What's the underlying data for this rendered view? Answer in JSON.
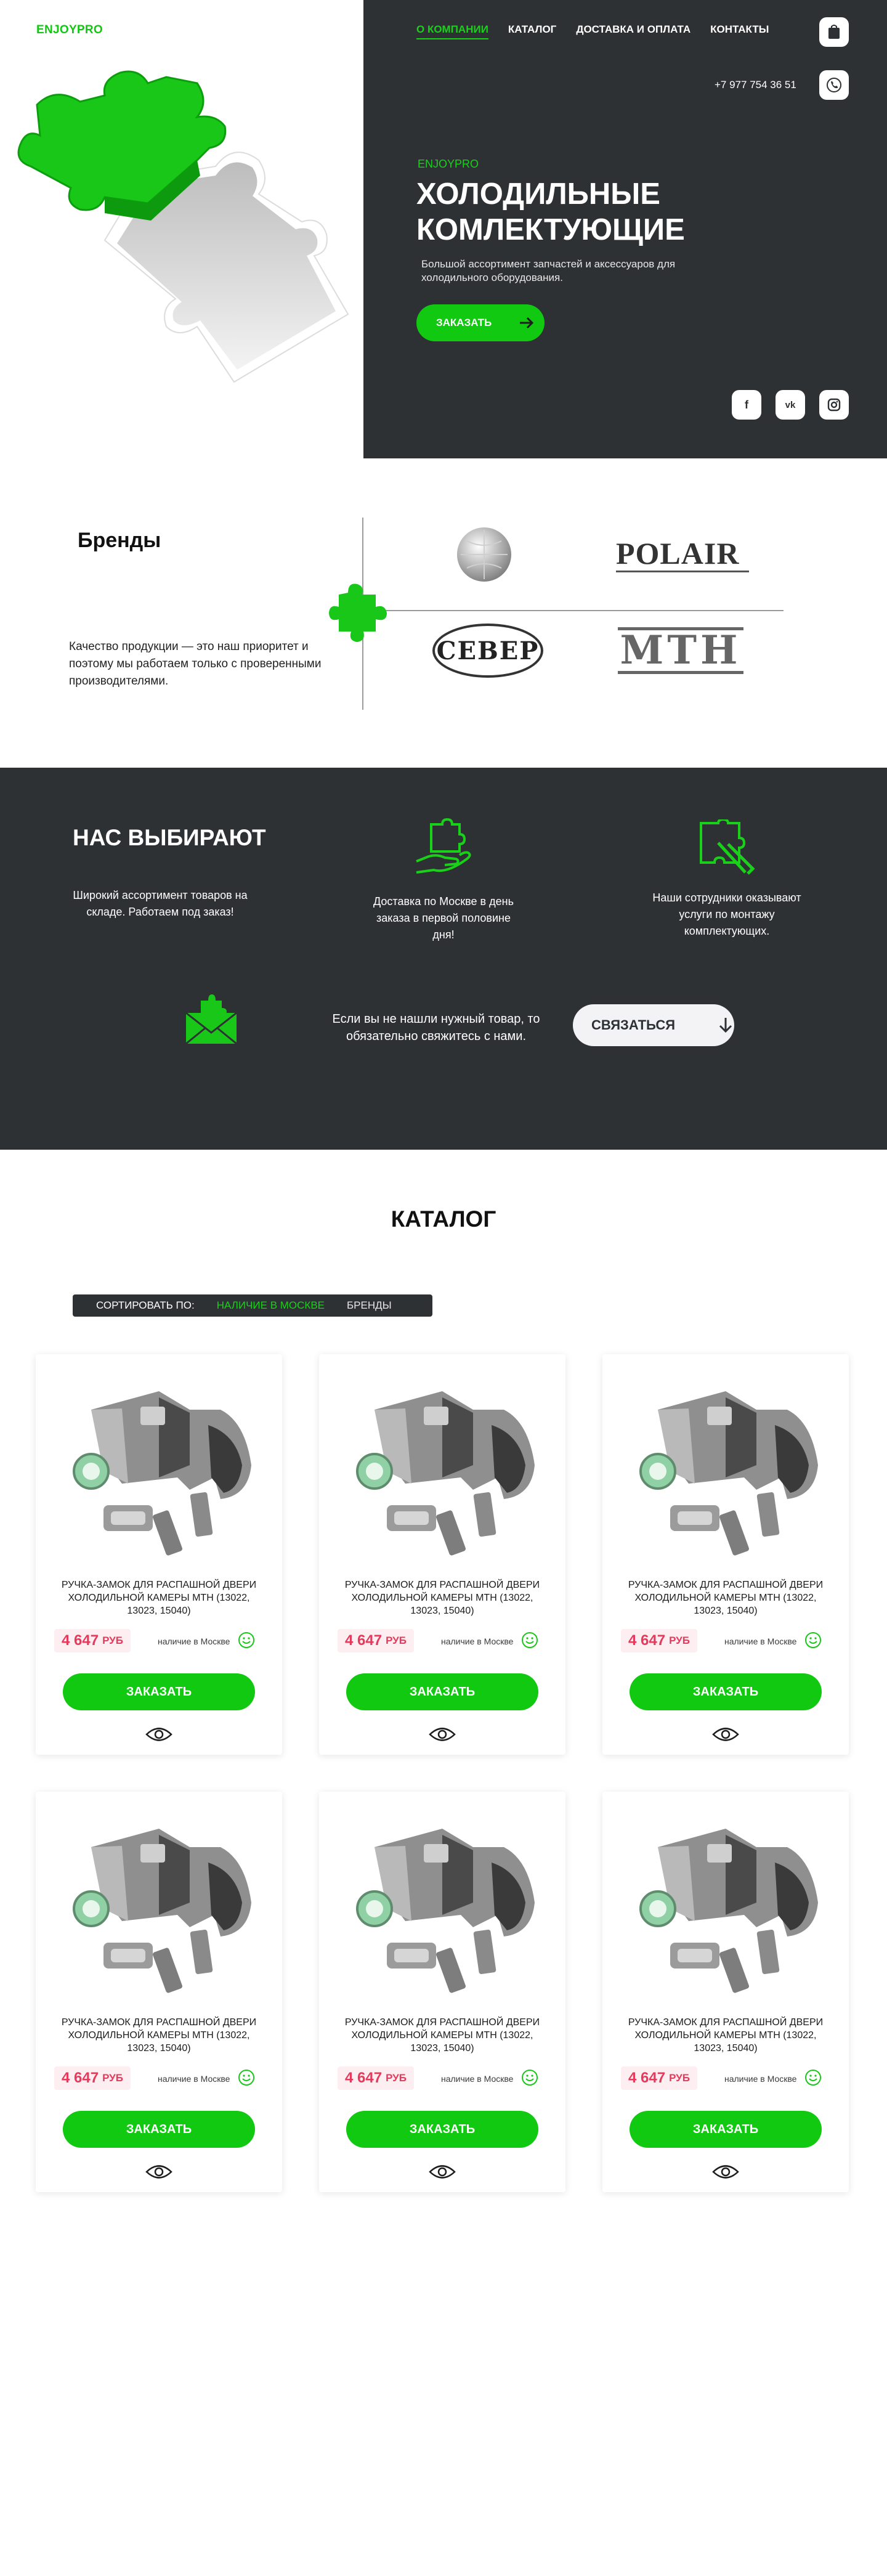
{
  "header": {
    "logo": "ENJOYPRO",
    "nav": [
      {
        "label": "О КОМПАНИИ",
        "active": true
      },
      {
        "label": "КАТАЛОГ",
        "active": false
      },
      {
        "label": "ДОСТАВКА И ОПЛАТА",
        "active": false
      },
      {
        "label": "КОНТАКТЫ",
        "active": false
      }
    ],
    "cart_icon": "cart-icon",
    "phone": "+7 977 754 36 51",
    "phone_icon": "phone-icon"
  },
  "hero": {
    "brand": "ENJOYPRO",
    "title": "ХОЛОДИЛЬНЫЕ КОМЛЕКТУЮЩИЕ",
    "subtitle": "Большой ассортимент запчастей и аксессуаров для холодильного оборудования.",
    "order_label": "ЗАКАЗАТЬ",
    "social": [
      "facebook-icon",
      "vk-icon",
      "instagram-icon"
    ]
  },
  "brands": {
    "title": "Бренды",
    "description": "Качество продукции — это наш приоритет и поэтому мы работаем только с проверенными производителями.",
    "logos": [
      {
        "name": "globe-logo",
        "text": ""
      },
      {
        "name": "polair-logo",
        "text": "POLAIR"
      },
      {
        "name": "sever-logo",
        "text": "СЕВЕР"
      },
      {
        "name": "mtn-logo",
        "text": "МТН"
      }
    ]
  },
  "why_us": {
    "title": "НАС ВЫБИРАЮТ",
    "features": [
      {
        "text": "Широкий ассортимент товаров на складе. Работаем под заказ!",
        "icon": ""
      },
      {
        "text": "Доставка по Москве в день заказа в первой половине дня!",
        "icon": "hand-puzzle-icon"
      },
      {
        "text": "Наши сотрудники оказывают услуги по монтажу комплектующих.",
        "icon": "puzzle-tools-icon"
      }
    ],
    "contact_text": "Если вы не нашли нужный  товар, то обязательно свяжитесь с нами.",
    "contact_icon": "mail-puzzle-icon",
    "contact_button": "СВЯЗАТЬСЯ"
  },
  "catalog": {
    "title": "КАТАЛОГ",
    "sort_label": "СОРТИРОВАТЬ ПО:",
    "sort_options": [
      {
        "label": "НАЛИЧИЕ В МОСКВЕ",
        "active": true
      },
      {
        "label": "БРЕНДЫ",
        "active": false
      }
    ],
    "products": [
      {
        "name": "РУЧКА-ЗАМОК ДЛЯ РАСПАШНОЙ ДВЕРИ ХОЛОДИЛЬНОЙ КАМЕРЫ МТН (13022, 13023, 15040)",
        "price": "4 647",
        "currency": "РУБ",
        "stock": "наличие в Москве",
        "button": "ЗАКАЗАТЬ"
      },
      {
        "name": "РУЧКА-ЗАМОК ДЛЯ РАСПАШНОЙ ДВЕРИ ХОЛОДИЛЬНОЙ КАМЕРЫ МТН (13022, 13023, 15040)",
        "price": "4 647",
        "currency": "РУБ",
        "stock": "наличие в Москве",
        "button": "ЗАКАЗАТЬ"
      },
      {
        "name": "РУЧКА-ЗАМОК ДЛЯ РАСПАШНОЙ ДВЕРИ ХОЛОДИЛЬНОЙ КАМЕРЫ МТН (13022, 13023, 15040)",
        "price": "4 647",
        "currency": "РУБ",
        "stock": "наличие в Москве",
        "button": "ЗАКАЗАТЬ"
      },
      {
        "name": "РУЧКА-ЗАМОК ДЛЯ РАСПАШНОЙ ДВЕРИ ХОЛОДИЛЬНОЙ КАМЕРЫ МТН (13022, 13023, 15040)",
        "price": "4 647",
        "currency": "РУБ",
        "stock": "наличие в Москве",
        "button": "ЗАКАЗАТЬ"
      },
      {
        "name": "РУЧКА-ЗАМОК ДЛЯ РАСПАШНОЙ ДВЕРИ ХОЛОДИЛЬНОЙ КАМЕРЫ МТН (13022, 13023, 15040)",
        "price": "4 647",
        "currency": "РУБ",
        "stock": "наличие в Москве",
        "button": "ЗАКАЗАТЬ"
      },
      {
        "name": "РУЧКА-ЗАМОК ДЛЯ РАСПАШНОЙ ДВЕРИ ХОЛОДИЛЬНОЙ КАМЕРЫ МТН (13022, 13023, 15040)",
        "price": "4 647",
        "currency": "РУБ",
        "stock": "наличие в Москве",
        "button": "ЗАКАЗАТЬ"
      }
    ]
  },
  "colors": {
    "accent": "#11c911",
    "dark": "#2e3134",
    "price": "#e53a5b"
  }
}
